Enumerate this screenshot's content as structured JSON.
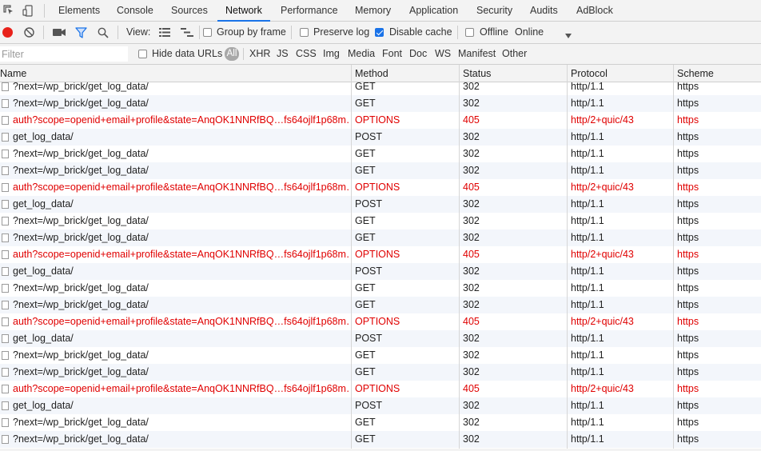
{
  "tabs": [
    {
      "label": "Elements"
    },
    {
      "label": "Console"
    },
    {
      "label": "Sources"
    },
    {
      "label": "Network",
      "active": true
    },
    {
      "label": "Performance"
    },
    {
      "label": "Memory"
    },
    {
      "label": "Application"
    },
    {
      "label": "Security"
    },
    {
      "label": "Audits"
    },
    {
      "label": "AdBlock"
    }
  ],
  "toolbar": {
    "view_label": "View:",
    "group_by_frame": {
      "label": "Group by frame",
      "checked": false
    },
    "preserve_log": {
      "label": "Preserve log",
      "checked": false
    },
    "disable_cache": {
      "label": "Disable cache",
      "checked": true
    },
    "offline": {
      "label": "Offline",
      "checked": false
    },
    "throttling": "Online",
    "record_color": "#e8221b",
    "accent_color": "#1a73e8"
  },
  "filterbar": {
    "placeholder": "Filter",
    "hide_data_urls": "Hide data URLs",
    "types": [
      "All",
      "XHR",
      "JS",
      "CSS",
      "Img",
      "Media",
      "Font",
      "Doc",
      "WS",
      "Manifest",
      "Other"
    ]
  },
  "columns": {
    "name": "Name",
    "method": "Method",
    "status": "Status",
    "protocol": "Protocol",
    "scheme": "Scheme"
  },
  "rows": [
    {
      "name": "?next=/wp_brick/get_log_data/",
      "method": "GET",
      "status": "302",
      "protocol": "http/1.1",
      "scheme": "https",
      "error": false
    },
    {
      "name": "?next=/wp_brick/get_log_data/",
      "method": "GET",
      "status": "302",
      "protocol": "http/1.1",
      "scheme": "https",
      "error": false
    },
    {
      "name": "auth?scope=openid+email+profile&state=AnqOK1NNRfBQ…fs64ojlf1p68m…",
      "method": "OPTIONS",
      "status": "405",
      "protocol": "http/2+quic/43",
      "scheme": "https",
      "error": true
    },
    {
      "name": "get_log_data/",
      "method": "POST",
      "status": "302",
      "protocol": "http/1.1",
      "scheme": "https",
      "error": false
    },
    {
      "name": "?next=/wp_brick/get_log_data/",
      "method": "GET",
      "status": "302",
      "protocol": "http/1.1",
      "scheme": "https",
      "error": false
    },
    {
      "name": "?next=/wp_brick/get_log_data/",
      "method": "GET",
      "status": "302",
      "protocol": "http/1.1",
      "scheme": "https",
      "error": false
    },
    {
      "name": "auth?scope=openid+email+profile&state=AnqOK1NNRfBQ…fs64ojlf1p68m…",
      "method": "OPTIONS",
      "status": "405",
      "protocol": "http/2+quic/43",
      "scheme": "https",
      "error": true
    },
    {
      "name": "get_log_data/",
      "method": "POST",
      "status": "302",
      "protocol": "http/1.1",
      "scheme": "https",
      "error": false
    },
    {
      "name": "?next=/wp_brick/get_log_data/",
      "method": "GET",
      "status": "302",
      "protocol": "http/1.1",
      "scheme": "https",
      "error": false
    },
    {
      "name": "?next=/wp_brick/get_log_data/",
      "method": "GET",
      "status": "302",
      "protocol": "http/1.1",
      "scheme": "https",
      "error": false
    },
    {
      "name": "auth?scope=openid+email+profile&state=AnqOK1NNRfBQ…fs64ojlf1p68m…",
      "method": "OPTIONS",
      "status": "405",
      "protocol": "http/2+quic/43",
      "scheme": "https",
      "error": true
    },
    {
      "name": "get_log_data/",
      "method": "POST",
      "status": "302",
      "protocol": "http/1.1",
      "scheme": "https",
      "error": false
    },
    {
      "name": "?next=/wp_brick/get_log_data/",
      "method": "GET",
      "status": "302",
      "protocol": "http/1.1",
      "scheme": "https",
      "error": false
    },
    {
      "name": "?next=/wp_brick/get_log_data/",
      "method": "GET",
      "status": "302",
      "protocol": "http/1.1",
      "scheme": "https",
      "error": false
    },
    {
      "name": "auth?scope=openid+email+profile&state=AnqOK1NNRfBQ…fs64ojlf1p68m…",
      "method": "OPTIONS",
      "status": "405",
      "protocol": "http/2+quic/43",
      "scheme": "https",
      "error": true
    },
    {
      "name": "get_log_data/",
      "method": "POST",
      "status": "302",
      "protocol": "http/1.1",
      "scheme": "https",
      "error": false
    },
    {
      "name": "?next=/wp_brick/get_log_data/",
      "method": "GET",
      "status": "302",
      "protocol": "http/1.1",
      "scheme": "https",
      "error": false
    },
    {
      "name": "?next=/wp_brick/get_log_data/",
      "method": "GET",
      "status": "302",
      "protocol": "http/1.1",
      "scheme": "https",
      "error": false
    },
    {
      "name": "auth?scope=openid+email+profile&state=AnqOK1NNRfBQ…fs64ojlf1p68m…",
      "method": "OPTIONS",
      "status": "405",
      "protocol": "http/2+quic/43",
      "scheme": "https",
      "error": true
    },
    {
      "name": "get_log_data/",
      "method": "POST",
      "status": "302",
      "protocol": "http/1.1",
      "scheme": "https",
      "error": false
    },
    {
      "name": "?next=/wp_brick/get_log_data/",
      "method": "GET",
      "status": "302",
      "protocol": "http/1.1",
      "scheme": "https",
      "error": false
    },
    {
      "name": "?next=/wp_brick/get_log_data/",
      "method": "GET",
      "status": "302",
      "protocol": "http/1.1",
      "scheme": "https",
      "error": false
    }
  ]
}
